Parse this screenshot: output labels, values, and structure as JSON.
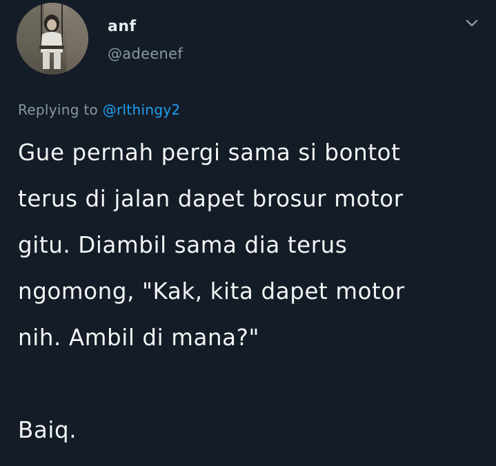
{
  "tweet": {
    "author": {
      "display_name": "anf",
      "handle": "@adeenef",
      "avatar_icon": "profile-photo-girl-on-swing"
    },
    "menu_icon": "chevron-down-icon",
    "reply_prefix": "Replying to ",
    "reply_mention": "@rlthingy2",
    "body_lines": [
      "Gue pernah pergi sama si bontot",
      "terus di jalan dapet brosur motor",
      "gitu. Diambil sama dia terus",
      "ngomong, \"Kak, kita dapet motor",
      "nih. Ambil di mana?\""
    ],
    "closing_line": "Baiq."
  },
  "colors": {
    "background": "#141c27",
    "primary_text": "#f3f4f5",
    "secondary_text": "#8899a6",
    "link": "#1da1f2"
  }
}
